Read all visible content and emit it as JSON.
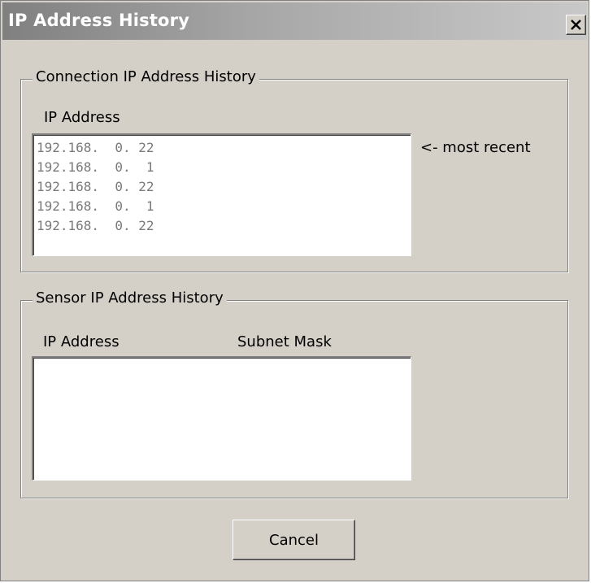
{
  "window": {
    "title": "IP Address History",
    "close_label": "Close"
  },
  "connection_group": {
    "legend": "Connection IP Address History",
    "column_ip": "IP Address",
    "recent_note": "<- most recent",
    "entries": [
      "192.168.  0. 22",
      "192.168.  0.  1",
      "192.168.  0. 22",
      "192.168.  0.  1",
      "192.168.  0. 22"
    ]
  },
  "sensor_group": {
    "legend": "Sensor IP Address History",
    "column_ip": "IP Address",
    "column_mask": "Subnet Mask",
    "entries": []
  },
  "buttons": {
    "cancel_label": "Cancel"
  }
}
